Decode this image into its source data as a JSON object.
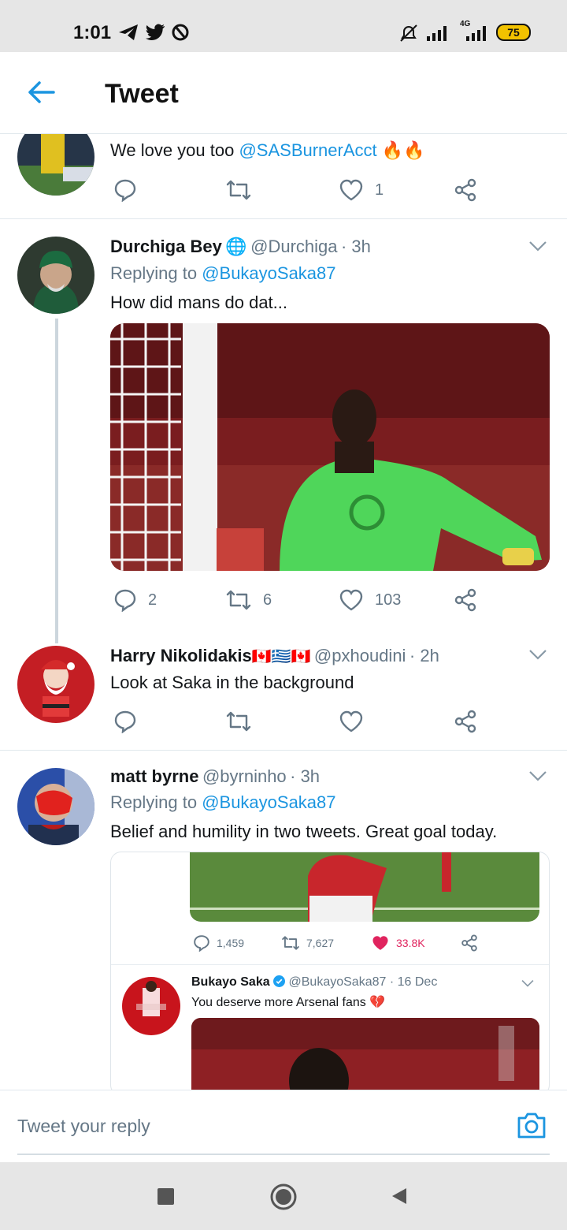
{
  "status_bar": {
    "time": "1:01",
    "battery": "75",
    "network": "4G",
    "icons": [
      "telegram-icon",
      "twitter-icon",
      "app-icon",
      "silent-icon",
      "signal-icon",
      "signal-4g-icon",
      "battery-icon"
    ]
  },
  "header": {
    "title": "Tweet",
    "back_icon": "arrow-left-icon"
  },
  "tweets": [
    {
      "text_prefix": "We love you too ",
      "mention": "@SASBurnerAcct",
      "emoji": "🔥🔥",
      "actions": {
        "replies": "",
        "retweets": "",
        "likes": "1"
      }
    },
    {
      "name": "Durchiga Bey",
      "badge": "🌐",
      "handle": "@Durchiga",
      "time": "· 3h",
      "replying_label": "Replying to ",
      "replying_to": "@BukayoSaka87",
      "text": "How did mans do dat...",
      "actions": {
        "replies": "2",
        "retweets": "6",
        "likes": "103"
      }
    },
    {
      "name": "Harry Nikolidakis",
      "flags": "🇨🇦🇬🇷🇨🇦",
      "handle": "@pxhoudini",
      "time": "· 2h",
      "text": "Look at Saka in the background",
      "actions": {
        "replies": "",
        "retweets": "",
        "likes": ""
      }
    },
    {
      "name": "matt byrne",
      "handle": "@byrninho",
      "time": "· 3h",
      "replying_label": "Replying to ",
      "replying_to": "@BukayoSaka87",
      "text": "Belief and humility in two tweets. Great goal today.",
      "quoted": {
        "stats": {
          "replies": "1,459",
          "retweets": "7,627",
          "likes": "33.8K"
        },
        "inner_name": "Bukayo Saka",
        "inner_handle": "@BukayoSaka87",
        "inner_time": "· 16 Dec",
        "inner_text": "You deserve more Arsenal fans",
        "inner_emoji": "💔"
      }
    }
  ],
  "reply_bar": {
    "placeholder": "Tweet your reply",
    "camera_icon": "camera-icon"
  },
  "nav_bar": {
    "icons": [
      "square-icon",
      "circle-home-icon",
      "triangle-back-icon"
    ]
  },
  "colors": {
    "link": "#1b95e0",
    "muted": "#657786",
    "like_active": "#e0245e"
  }
}
